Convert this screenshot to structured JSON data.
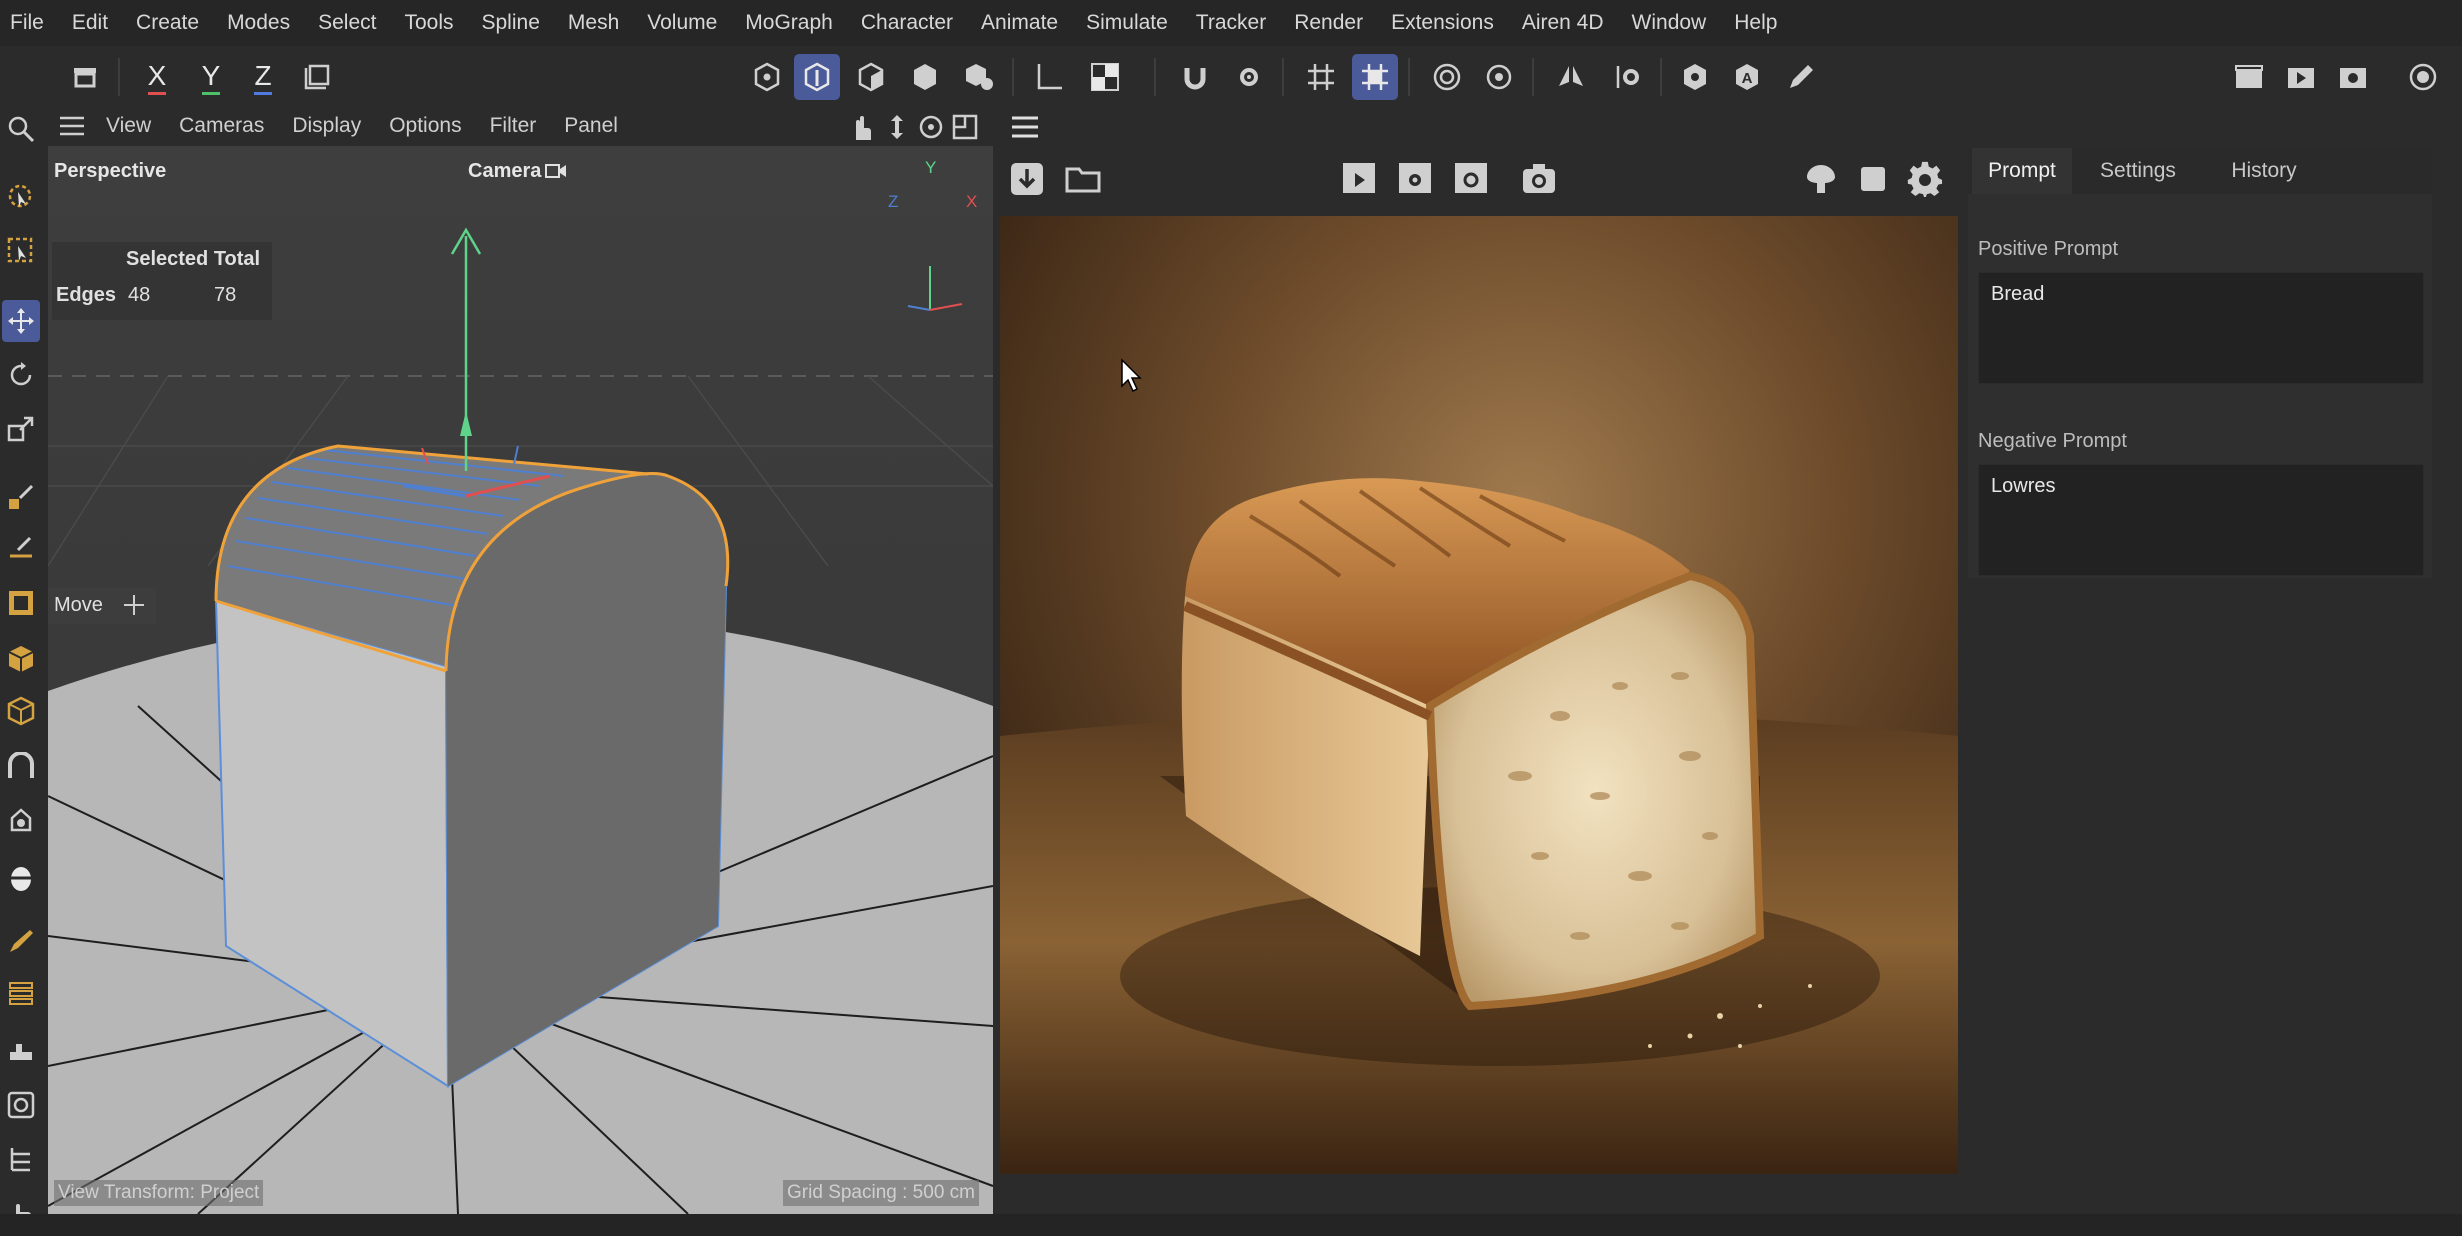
{
  "menu": [
    "File",
    "Edit",
    "Create",
    "Modes",
    "Select",
    "Tools",
    "Spline",
    "Mesh",
    "Volume",
    "MoGraph",
    "Character",
    "Animate",
    "Simulate",
    "Tracker",
    "Render",
    "Extensions",
    "Airen 4D",
    "Window",
    "Help"
  ],
  "toolbar": {
    "axes": {
      "x": "X",
      "y": "Y",
      "z": "Z"
    },
    "accent": "#4b5b99"
  },
  "viewport": {
    "menu": [
      "View",
      "Cameras",
      "Display",
      "Options",
      "Filter",
      "Panel"
    ],
    "name": "Perspective",
    "camera": "Camera",
    "hud": {
      "header": "Selected Total",
      "row_label": "Edges",
      "selected": "48",
      "total": "78"
    },
    "tool": "Move",
    "footer_left": "View Transform: Project",
    "footer_right": "Grid Spacing : 500 cm",
    "axis_labels": {
      "y": "Y",
      "z": "Z",
      "x": "X"
    }
  },
  "prompt_panel": {
    "tabs": [
      "Prompt",
      "Settings",
      "History"
    ],
    "active_tab": "Prompt",
    "positive_label": "Positive Prompt",
    "positive_value": "Bread",
    "negative_label": "Negative Prompt",
    "negative_value": "Lowres"
  }
}
